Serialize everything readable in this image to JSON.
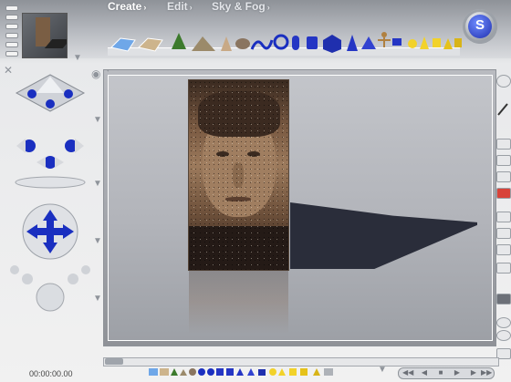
{
  "menu": {
    "create": "Create",
    "edit": "Edit",
    "sky_fog": "Sky & Fog",
    "arrow": "›"
  },
  "timecode": "00:00:00.00",
  "logo": {
    "glyph": "S"
  },
  "colors": {
    "accent_blue": "#1f2fae",
    "primitive_yellow": "#f2d22a",
    "primitive_blue": "#1a2fc0"
  },
  "icons": {
    "menu_arrow": "chevron-right-icon",
    "palette_primitives": [
      "water-tile-icon",
      "sand-tile-icon",
      "tree-icon",
      "terrain-icon",
      "cone-icon",
      "rock-icon",
      "spiral-icon",
      "torus-icon",
      "capsule-icon",
      "cylinder-icon",
      "cube-icon",
      "cone-blue-icon",
      "pyramid-icon",
      "figure-icon",
      "flag-icon",
      "sphere-yellow-icon",
      "cone-yellow-icon",
      "cube-yellow-icon",
      "prism-yellow-icon",
      "cube-gold-icon"
    ]
  }
}
